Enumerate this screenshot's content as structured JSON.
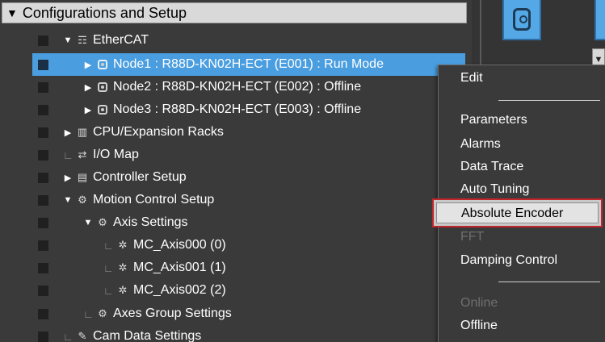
{
  "section": {
    "title": "Configurations and Setup"
  },
  "tree": [
    {
      "label": "EtherCAT",
      "expander": "▼",
      "icon": "network-icon",
      "glyph": "☶"
    },
    {
      "label": "Node1 : R88D-KN02H-ECT (E001) : Run Mode",
      "expander": "▶",
      "icon": "servo-node-icon",
      "selected": true
    },
    {
      "label": "Node2 : R88D-KN02H-ECT (E002) : Offline",
      "expander": "▶",
      "icon": "servo-node-icon"
    },
    {
      "label": "Node3 : R88D-KN02H-ECT (E003) : Offline",
      "expander": "▶",
      "icon": "servo-node-icon"
    },
    {
      "label": "CPU/Expansion Racks",
      "expander": "▶",
      "icon": "rack-icon",
      "glyph": "▥"
    },
    {
      "label": "I/O Map",
      "expander": "",
      "icon": "io-map-icon",
      "glyph": "⇄"
    },
    {
      "label": "Controller Setup",
      "expander": "▶",
      "icon": "controller-setup-icon",
      "glyph": "▤"
    },
    {
      "label": "Motion Control Setup",
      "expander": "▼",
      "icon": "gear-icon",
      "glyph": "⚙"
    },
    {
      "label": "Axis Settings",
      "expander": "▼",
      "icon": "gear-icon",
      "glyph": "⚙"
    },
    {
      "label": "MC_Axis000 (0)",
      "expander": "",
      "icon": "axis-icon",
      "glyph": "✲"
    },
    {
      "label": "MC_Axis001 (1)",
      "expander": "",
      "icon": "axis-icon",
      "glyph": "✲"
    },
    {
      "label": "MC_Axis002 (2)",
      "expander": "",
      "icon": "axis-icon",
      "glyph": "✲"
    },
    {
      "label": "Axes Group Settings",
      "expander": "",
      "icon": "axes-group-icon",
      "glyph": "⚙"
    },
    {
      "label": "Cam Data Settings",
      "expander": "",
      "icon": "cam-data-icon",
      "glyph": "✎"
    }
  ],
  "context_menu": {
    "items": [
      {
        "label": "Edit",
        "disabled": false
      },
      {
        "label": "Parameters",
        "disabled": false
      },
      {
        "label": "Alarms",
        "disabled": false
      },
      {
        "label": "Data Trace",
        "disabled": false
      },
      {
        "label": "Auto Tuning",
        "disabled": false
      },
      {
        "label": "Absolute Encoder",
        "disabled": false,
        "highlighted": true
      },
      {
        "label": "FFT",
        "disabled": true
      },
      {
        "label": "Damping Control",
        "disabled": false
      },
      {
        "label": "Online",
        "disabled": true
      },
      {
        "label": "Offline",
        "disabled": false
      }
    ]
  },
  "colors": {
    "selection": "#4a9ee0",
    "highlight_border": "#c0262c",
    "panel_bg": "#3a3a3a"
  }
}
